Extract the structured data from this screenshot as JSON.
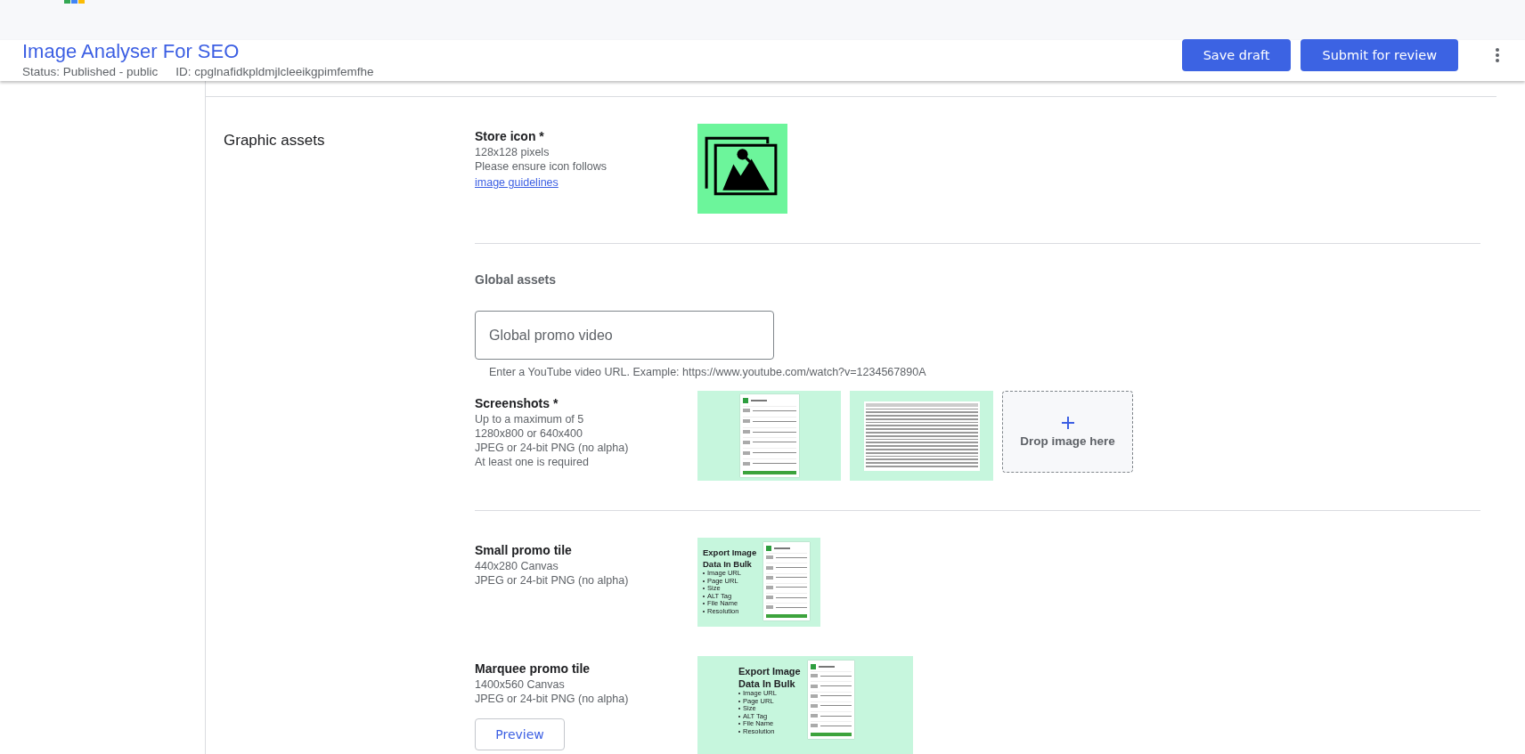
{
  "header": {
    "title": "Image Analyser For SEO",
    "status": "Status: Published - public",
    "id": "ID: cpglnafidkpldmjlcleeikgpimfemfhe",
    "buttons": [
      "Save draft",
      "Submit for review"
    ]
  },
  "section": {
    "title": "Graphic assets"
  },
  "store_icon": {
    "label": "Store icon *",
    "lines": [
      "128x128 pixels",
      "Please ensure icon follows"
    ],
    "link": "image guidelines"
  },
  "global_assets": {
    "title": "Global assets",
    "video_field": {
      "placeholder": "Global promo video"
    },
    "hint": "Enter a YouTube video URL. Example: https://www.youtube.com/watch?v=1234567890A"
  },
  "screenshots": {
    "label": "Screenshots *",
    "lines": [
      "Up to a maximum of 5",
      "1280x800 or 640x400",
      "JPEG or 24-bit PNG (no alpha)",
      "At least one is required"
    ],
    "items": [
      {
        "kind": "list"
      },
      {
        "kind": "table"
      }
    ],
    "drop": "Drop image here"
  },
  "promo_tiles": [
    {
      "kind": "small",
      "label": "Small promo tile",
      "lines": [
        "440x280 Canvas",
        "JPEG or 24-bit PNG (no alpha)"
      ],
      "headline": [
        "Export Image",
        "Data In Bulk"
      ],
      "bullets": [
        "Image URL",
        "Page URL",
        "Size",
        "ALT Tag",
        "File Name",
        "Resolution"
      ]
    },
    {
      "kind": "marquee",
      "label": "Marquee promo tile",
      "lines": [
        "1400x560 Canvas",
        "JPEG or 24-bit PNG (no alpha)"
      ],
      "button": "Preview",
      "headline": [
        "Export Image",
        "Data In Bulk"
      ],
      "bullets": [
        "Image URL",
        "Page URL",
        "Size",
        "ALT Tag",
        "File Name",
        "Resolution"
      ]
    }
  ]
}
